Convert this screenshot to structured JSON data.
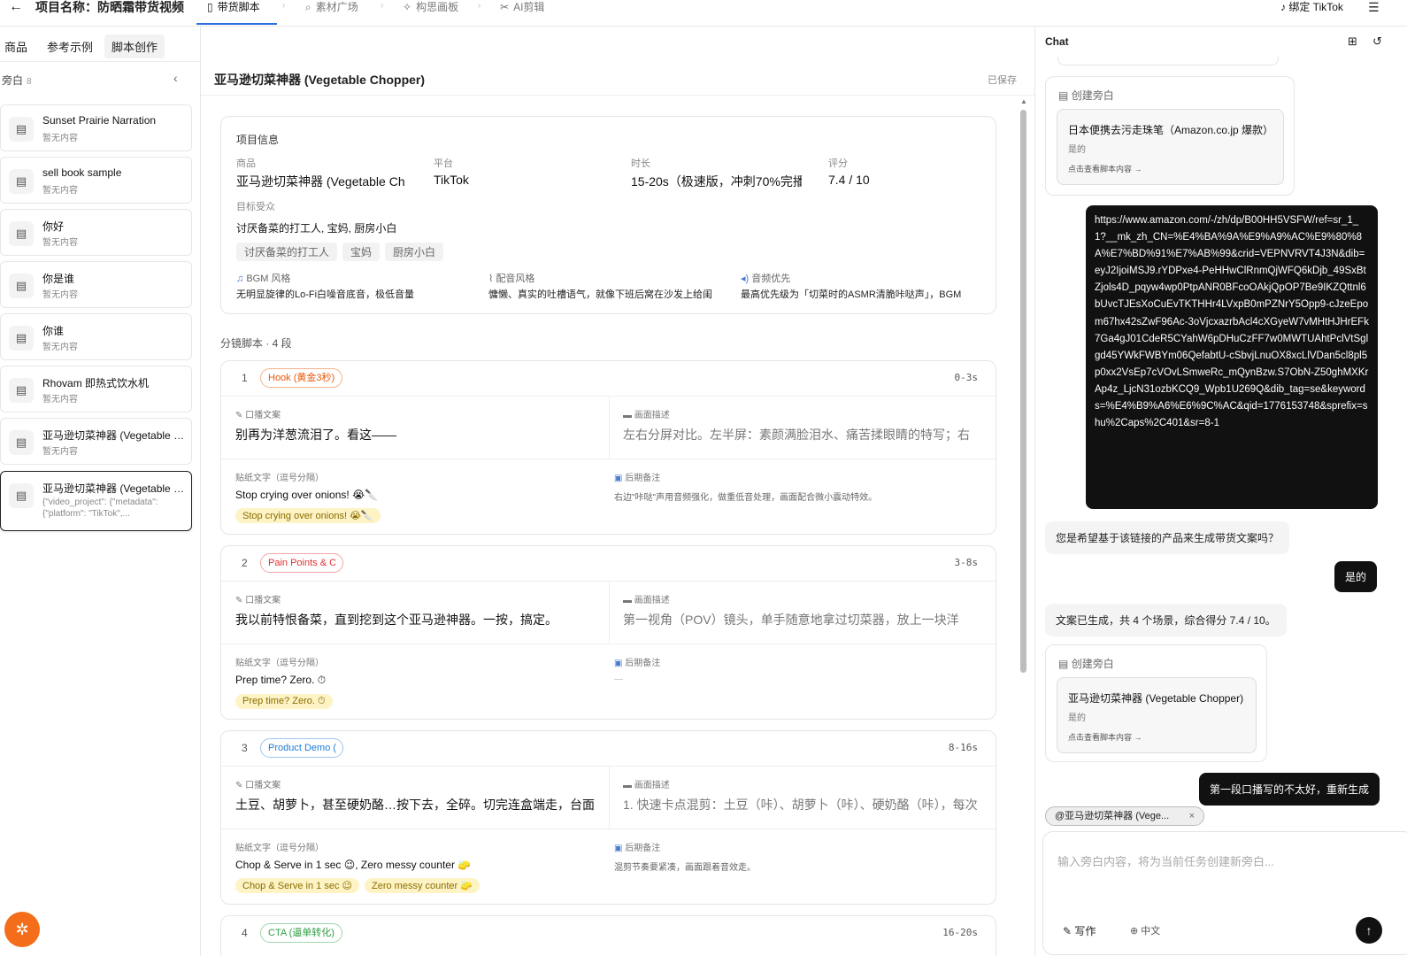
{
  "topbar": {
    "back_icon": "arrow-left-icon",
    "project_title": "项目名称：防晒霜带货视频",
    "steps": [
      {
        "label": "带货脚本",
        "icon": "document-icon",
        "active": true
      },
      {
        "label": "素材广场",
        "icon": "search-icon",
        "active": false
      },
      {
        "label": "构思画板",
        "icon": "sparkle-icon",
        "active": false
      },
      {
        "label": "AI剪辑",
        "icon": "scissors-icon",
        "active": false
      }
    ],
    "tiktok_label": "绑定 TikTok",
    "accent_color": "#2f6fe0"
  },
  "left_tabs": [
    "商品",
    "参考示例",
    "脚本创作"
  ],
  "sidebar": {
    "title": "旁白",
    "count": "8",
    "items": [
      {
        "title": "Sunset Prairie Narration",
        "sub": "暂无内容"
      },
      {
        "title": "sell book sample",
        "sub": "暂无内容"
      },
      {
        "title": "你好",
        "sub": "暂无内容"
      },
      {
        "title": "你是谁",
        "sub": "暂无内容"
      },
      {
        "title": "你谁",
        "sub": "暂无内容"
      },
      {
        "title": "Rhovam 即热式饮水机",
        "sub": "暂无内容"
      },
      {
        "title": "亚马逊切菜神器 (Vegetable Chopper)",
        "sub": "暂无内容"
      },
      {
        "title": "亚马逊切菜神器 (Vegetable Chopper)",
        "sub": "{\"video_project\": {\"metadata\": {\"platform\": \"TikTok\",..."
      }
    ]
  },
  "bug_icon": "bug-icon",
  "main": {
    "title": "亚马逊切菜神器 (Vegetable Chopper)",
    "saved": "已保存",
    "info": {
      "heading": "项目信息",
      "product_label": "商品",
      "product_value": "亚马逊切菜神器 (Vegetable Ch",
      "platform_label": "平台",
      "platform_value": "TikTok",
      "duration_label": "时长",
      "duration_value": "15-20s（极速版，冲刺70%完播",
      "score_label": "评分",
      "score_value": "7.4 / 10",
      "audience_label": "目标受众",
      "audience_value": "讨厌备菜的打工人, 宝妈, 厨房小白",
      "audience_chips": [
        "讨厌备菜的打工人",
        "宝妈",
        "厨房小白"
      ],
      "bgm_label": "BGM 风格",
      "bgm_value": "无明显旋律的Lo-Fi白噪音底音，极低音量",
      "voice_label": "配音风格",
      "voice_value": "慵懒、真实的吐槽语气，就像下班后窝在沙发上给闺",
      "audio_label": "音频优先",
      "audio_value": "最高优先级为「切菜时的ASMR清脆咔哒声」，BGM"
    },
    "segments_title": "分镜脚本 · 4 段",
    "seg_labels": {
      "voice": "口播文案",
      "scene": "画面描述",
      "sticker": "贴纸文字（逗号分隔）",
      "post": "后期备注"
    },
    "segments": [
      {
        "num": "1",
        "tag": "Hook (黄金3秒)",
        "tag_color": "#e8590c",
        "time": "0-3s",
        "voice": "别再为洋葱流泪了。看这——",
        "scene": "左右分屏对比。左半屏：素颜满脸泪水、痛苦揉眼睛的特写；右",
        "sticker": "Stop crying over onions! 😭🔪",
        "note": "右边\"咔哒\"声用音频强化，做重低音处理，画面配合微小震动特效。",
        "chips": [
          "Stop crying over onions! 😭🔪"
        ]
      },
      {
        "num": "2",
        "tag": "Pain Points & C",
        "tag_color": "#e03131",
        "time": "3-8s",
        "voice": "我以前特恨备菜，直到挖到这个亚马逊神器。一按，搞定。",
        "scene": "第一视角（POV）镜头，单手随意地拿过切菜器，放上一块洋",
        "sticker": "Prep time? Zero. ⏱",
        "note": "—",
        "chips": [
          "Prep time? Zero. ⏱"
        ]
      },
      {
        "num": "3",
        "tag": "Product Demo (",
        "tag_color": "#1c7ed6",
        "time": "8-16s",
        "voice": "土豆、胡萝卜，甚至硬奶酪…按下去，全碎。切完连盒端走，台面",
        "scene": "1. 快速卡点混剪：土豆（咔）、胡萝卜（咔）、硬奶酪（咔），每次",
        "sticker": "Chop & Serve in 1 sec 😉, Zero messy counter 🧽",
        "note": "混剪节奏要紧凑，画面跟着音效走。",
        "chips": [
          "Chop & Serve in 1 sec 😉",
          "Zero messy counter 🧽"
        ]
      },
      {
        "num": "4",
        "tag": "CTA (逼单转化)",
        "tag_color": "#2f9e44",
        "time": "16-20s"
      }
    ]
  },
  "chat": {
    "title": "Chat",
    "create_label": "创建旁白",
    "card1": {
      "title": "日本便携去污走珠笔（Amazon.co.jp 爆款）",
      "sub": "是的",
      "link": "点击查看脚本内容 →"
    },
    "url_message": "https://www.amazon.com/-/zh/dp/B00HH5VSFW/ref=sr_1_1?__mk_zh_CN=%E4%BA%9A%E9%A9%AC%E9%80%8A%E7%BD%91%E7%AB%99&crid=VEPNVRVT4J3N&dib=eyJ2IjoiMSJ9.rYDPxe4-PeHHwClRnmQjWFQ6kDjb_49SxBtZjols4D_pqyw4wp0PtpANR0BFcoOAkjQpOP7Be9IKZQttnl6bUvcTJEsXoCuEvTKTHHr4LVxpB0mPZNrY5Opp9-cJzeEpom67hx42sZwF96Ac-3oVjcxazrbAcl4cXGyeW7vMHtHJHrEFk7Ga4gJ01CdeR5CYahW6pDHuCzFF7w0MWTUAhtPclVtSglgd45YWkFWBYm06QefabtU-cSbvjLnuOX8xcLlVDan5cl8pl5p0xx2VsEp7cVOvLSmweRc_mQynBzw.S7ObN-Z50ghMXKrAp4z_LjcN31ozbKCQ9_Wpb1U269Q&dib_tag=se&keywords=%E4%B9%A6%E6%9C%AC&qid=1776153748&sprefix=shu%2Caps%2C401&sr=8-1",
    "bot_question": "您是希望基于该链接的产品来生成带货文案吗？",
    "user_yes": "是的",
    "bot_done": "文案已生成，共 4 个场景，综合得分 7.4 / 10。",
    "card2": {
      "title": "亚马逊切菜神器 (Vegetable Chopper)",
      "sub": "是的",
      "link": "点击查看脚本内容 →"
    },
    "user_last": "第一段口播写的不太好，重新生成",
    "ref_chip": "@亚马逊切菜神器 (Vege...",
    "input_placeholder": "输入旁白内容，将为当前任务创建新旁白...",
    "write_label": "写作",
    "lang_label": "中文"
  }
}
